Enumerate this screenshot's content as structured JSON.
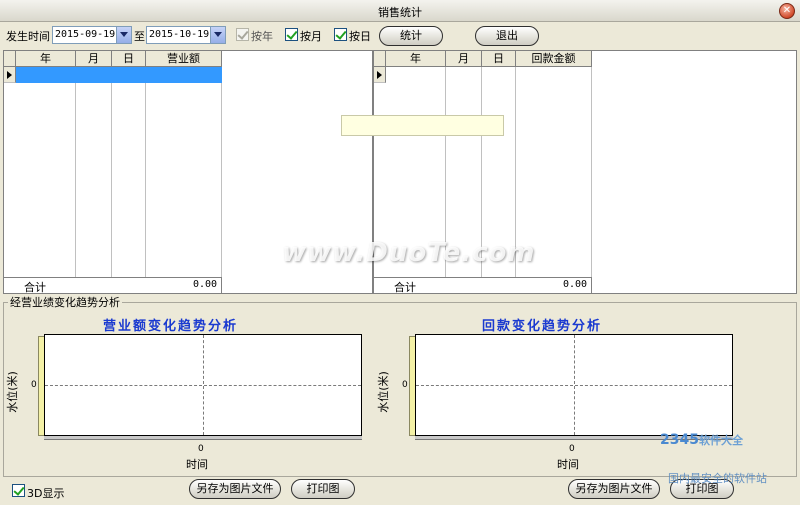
{
  "window": {
    "title": "销售统计",
    "close_glyph": "✕"
  },
  "toolbar": {
    "date_label": "发生时间",
    "start_date": "2015-09-19",
    "to_label": "至",
    "end_date": "2015-10-19",
    "by_year_label": "按年",
    "by_month_label": "按月",
    "by_day_label": "按日",
    "stats_button": "统计",
    "exit_button": "退出"
  },
  "sales_grid": {
    "headers": [
      "年",
      "月",
      "日",
      "营业额"
    ],
    "total_label": "合计",
    "total_value": "0.00"
  },
  "payment_grid": {
    "headers": [
      "年",
      "月",
      "日",
      "回款金额"
    ],
    "total_label": "合计",
    "total_value": "0.00"
  },
  "analysis": {
    "group_label": "经营业绩变化趋势分析",
    "show_3d_label": "3D显示",
    "save_image_button": "另存为图片文件",
    "print_button": "打印图"
  },
  "chart_data": [
    {
      "type": "line",
      "title": "营业额变化趋势分析",
      "xlabel": "时间",
      "ylabel": "水位(米)",
      "x_ticks": [
        "0"
      ],
      "y_ticks": [
        "0"
      ],
      "series": [],
      "grid": true
    },
    {
      "type": "line",
      "title": "回款变化趋势分析",
      "xlabel": "时间",
      "ylabel": "水位(米)",
      "x_ticks": [
        "0"
      ],
      "y_ticks": [
        "0"
      ],
      "series": [],
      "grid": true
    }
  ],
  "watermarks": {
    "duote": "www.DuoTe.com",
    "logo_number": "2345",
    "logo_suffix": "软件大全",
    "logo_sub": "国内最安全的软件站"
  },
  "states": {
    "by_year": true,
    "by_year_disabled": true,
    "by_month": true,
    "by_day": true,
    "show_3d": true
  }
}
